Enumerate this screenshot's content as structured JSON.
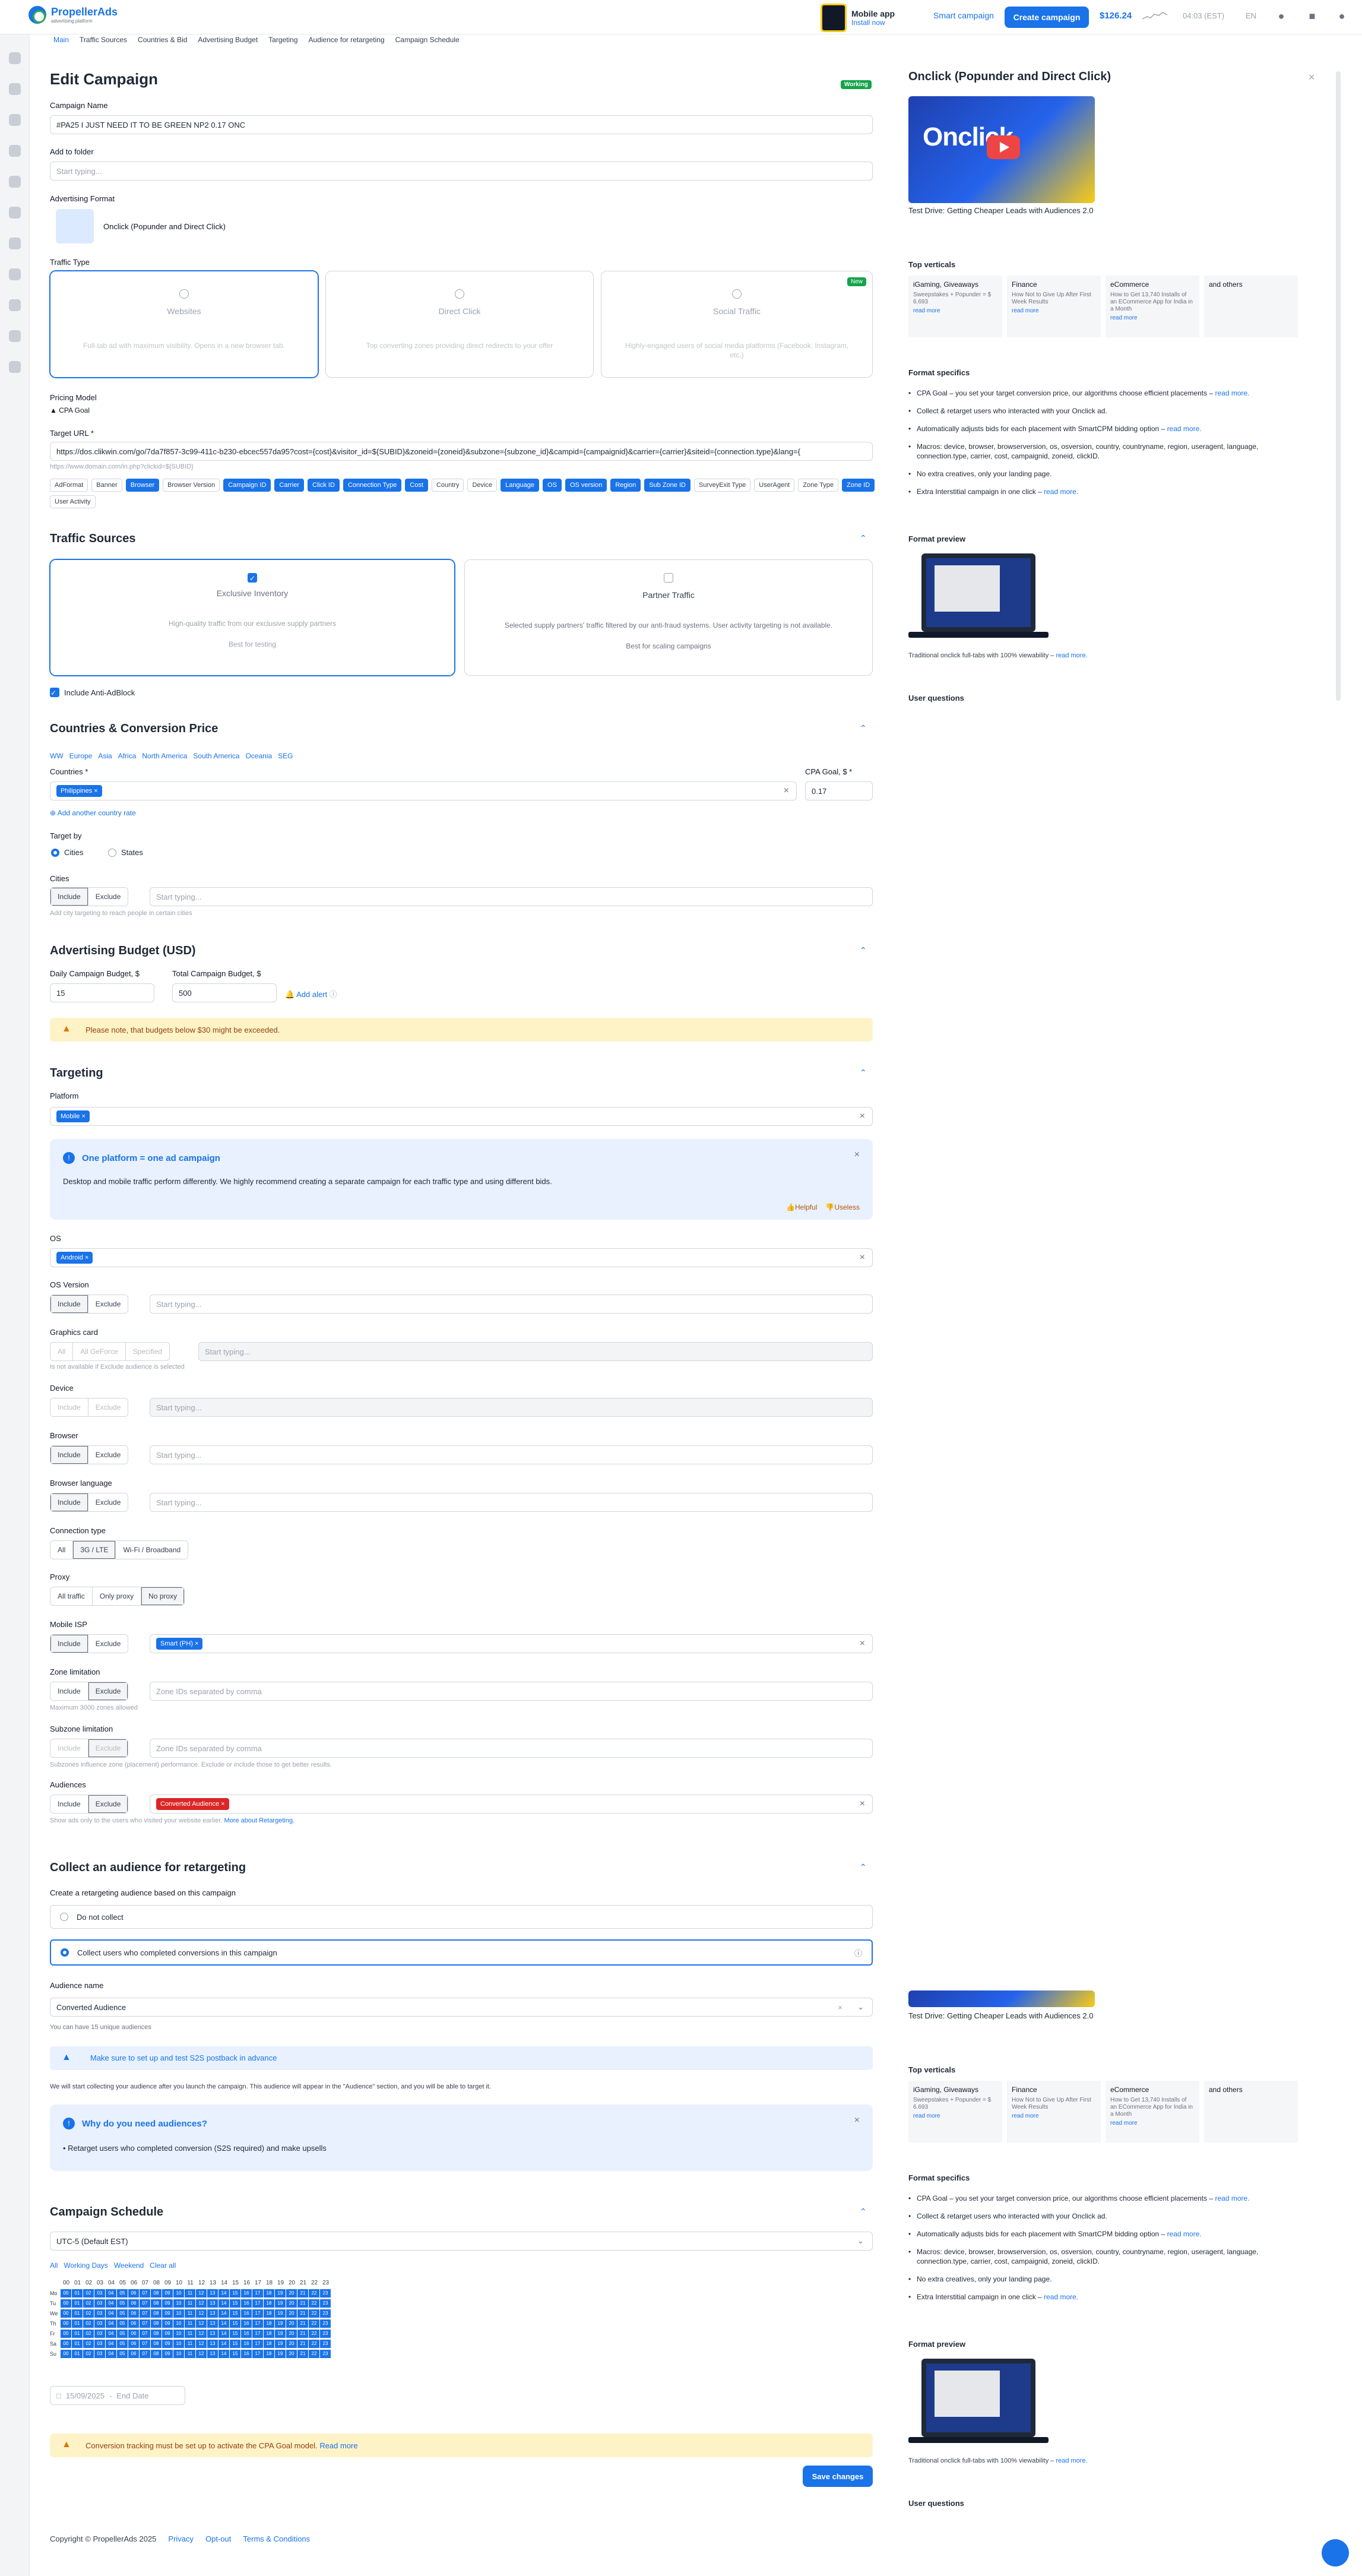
{
  "header": {
    "logo_name": "PropellerAds",
    "logo_sub": "advertising platform",
    "mobile_app_title": "Mobile app",
    "mobile_app_link": "Install now",
    "smart_campaign": "Smart campaign",
    "create_campaign": "Create campaign",
    "balance": "$126.24",
    "time": "04:03 (EST)",
    "lang": "EN"
  },
  "subnav": [
    "Main",
    "Traffic Sources",
    "Countries & Bid",
    "Advertising Budget",
    "Targeting",
    "Audience for retargeting",
    "Campaign Schedule"
  ],
  "page": {
    "title": "Edit Campaign",
    "status": "Working",
    "campaign_name_label": "Campaign Name",
    "campaign_name": "#PA25 I JUST NEED IT TO BE GREEN NP2 0.17 ONC",
    "folder_label": "Add to folder",
    "folder_placeholder": "Start typing...",
    "format_label": "Advertising Format",
    "format_value": "Onclick (Popunder and Direct Click)",
    "traffic_type_label": "Traffic Type",
    "traffic_types": [
      {
        "title": "Websites",
        "desc": "Full-tab ad with maximum visibility. Opens in a new browser tab."
      },
      {
        "title": "Direct Click",
        "desc": "Top converting zones providing direct redirects to your offer"
      },
      {
        "title": "Social Traffic",
        "desc": "Highly-engaged users of social media platforms (Facebook, Instagram, etc.)",
        "badge": "New"
      }
    ],
    "pricing_label": "Pricing Model",
    "pricing_value": "CPA Goal",
    "target_url_label": "Target URL *",
    "target_url": "https://dos.clikwin.com/go/7da7f857-3c99-411c-b230-ebcec557da95?cost={cost}&visitor_id=${SUBID}&zoneid={zoneid}&subzone={subzone_id}&campid={campaignid}&carrier={carrier}&siteid={connection.type}&lang={",
    "target_url_hint": "https://www.domain.com/in.php?clickid=${SUBID}",
    "macros": [
      {
        "t": "AdFormat",
        "on": false
      },
      {
        "t": "Banner",
        "on": false
      },
      {
        "t": "Browser",
        "on": true
      },
      {
        "t": "Browser Version",
        "on": false
      },
      {
        "t": "Campaign ID",
        "on": true
      },
      {
        "t": "Carrier",
        "on": true
      },
      {
        "t": "Click ID",
        "on": true
      },
      {
        "t": "Connection Type",
        "on": true
      },
      {
        "t": "Cost",
        "on": true
      },
      {
        "t": "Country",
        "on": false
      },
      {
        "t": "Device",
        "on": false
      },
      {
        "t": "Language",
        "on": true
      },
      {
        "t": "OS",
        "on": true
      },
      {
        "t": "OS version",
        "on": true
      },
      {
        "t": "Region",
        "on": true
      },
      {
        "t": "Sub Zone ID",
        "on": true
      },
      {
        "t": "SurveyExit Type",
        "on": false
      },
      {
        "t": "UserAgent",
        "on": false
      },
      {
        "t": "Zone Type",
        "on": false
      },
      {
        "t": "Zone ID",
        "on": true
      },
      {
        "t": "User Activity",
        "on": false
      }
    ]
  },
  "traffic_sources": {
    "title": "Traffic Sources",
    "exclusive_title": "Exclusive Inventory",
    "exclusive_desc": "High-quality traffic from our exclusive supply partners",
    "exclusive_foot": "Best for testing",
    "partner_title": "Partner Traffic",
    "partner_desc": "Selected supply partners' traffic filtered by our anti-fraud systems. User activity targeting is not available.",
    "partner_foot": "Best for scaling campaigns",
    "antiadblock": "Include Anti-AdBlock"
  },
  "countries": {
    "title": "Countries & Conversion Price",
    "regions": [
      "WW",
      "Europe",
      "Asia",
      "Africa",
      "North America",
      "South America",
      "Oceania",
      "SEG"
    ],
    "countries_label": "Countries *",
    "country_tag": "Philippines",
    "cpa_label": "CPA Goal, $ *",
    "cpa_value": "0.17",
    "add_rate": "Add another country rate",
    "target_by": "Target by",
    "cities": "Cities",
    "states": "States",
    "cities_label": "Cities",
    "include": "Include",
    "exclude": "Exclude",
    "cities_placeholder": "Start typing...",
    "cities_hint": "Add city targeting to reach people in certain cities"
  },
  "budget": {
    "title": "Advertising Budget (USD)",
    "daily_label": "Daily Campaign Budget, $",
    "daily": "15",
    "total_label": "Total Campaign Budget, $",
    "total": "500",
    "add_alert": "Add alert",
    "warning": "Please note, that budgets below $30 might be exceeded."
  },
  "targeting": {
    "title": "Targeting",
    "platform_label": "Platform",
    "platform_tag": "Mobile",
    "info_title": "One platform = one ad campaign",
    "info_text": "Desktop and mobile traffic perform differently. We highly recommend creating a separate campaign for each traffic type and using different bids.",
    "helpful": "Helpful",
    "useless": "Useless",
    "os_label": "OS",
    "os_tag": "Android",
    "osv_label": "OS Version",
    "gc_label": "Graphics card",
    "gc_all": "All",
    "gc_geforce": "All GeForce",
    "gc_specified": "Specified",
    "gc_hint": "Is not available if Exclude audience is selected",
    "device_label": "Device",
    "browser_label": "Browser",
    "blang_label": "Browser language",
    "conn_label": "Connection type",
    "conn": [
      "All",
      "3G / LTE",
      "Wi-Fi / Broadband"
    ],
    "proxy_label": "Proxy",
    "proxy": [
      "All traffic",
      "Only proxy",
      "No proxy"
    ],
    "isp_label": "Mobile ISP",
    "isp_tag": "Smart (PH)",
    "zone_label": "Zone limitation",
    "zone_placeholder": "Zone IDs separated by comma",
    "zone_hint": "Maximum 3000 zones allowed",
    "subzone_label": "Subzone limitation",
    "subzone_hint": "Subzones influence zone (placement) performance. Exclude or include those to get better results.",
    "aud_label": "Audiences",
    "aud_tag": "Converted Audience",
    "aud_hint": "Show ads only to the users who visited your website earlier.",
    "aud_link": "More about Retargeting.",
    "placeholder": "Start typing..."
  },
  "retargeting": {
    "title": "Collect an audience for retargeting",
    "subtitle": "Create a retargeting audience based on this campaign",
    "opt1": "Do not collect",
    "opt2": "Collect users who completed conversions in this campaign",
    "aud_name_label": "Audience name",
    "aud_name": "Converted Audience",
    "aud_count": "You can have 15 unique audiences",
    "s2s": "Make sure to set up and test S2S postback in advance",
    "note": "We will start collecting your audience after you launch the campaign. This audience will appear in the \"Audience\" section, and you will be able to target it.",
    "why_title": "Why do you need audiences?",
    "why_text": "• Retarget users who completed conversion (S2S required) and make upsells"
  },
  "schedule": {
    "title": "Campaign Schedule",
    "tz": "UTC-5 (Default EST)",
    "quick": [
      "All",
      "Working Days",
      "Weekend",
      "Clear all"
    ],
    "days": [
      "Mo",
      "Tu",
      "We",
      "Th",
      "Fr",
      "Sa",
      "Su"
    ],
    "hours": [
      "00",
      "01",
      "02",
      "03",
      "04",
      "05",
      "06",
      "07",
      "08",
      "09",
      "10",
      "11",
      "12",
      "13",
      "14",
      "15",
      "16",
      "17",
      "18",
      "19",
      "20",
      "21",
      "22",
      "23"
    ],
    "start_date": "15/09/2025",
    "end_date": "End Date",
    "cpa_warning": "Conversion tracking must be set up to activate the CPA Goal model.",
    "read_more": "Read more",
    "save": "Save changes"
  },
  "footer": {
    "copy": "Copyright © PropellerAds 2025",
    "links": [
      "Privacy",
      "Opt-out",
      "Terms & Conditions"
    ]
  },
  "panel": {
    "title": "Onclick (Popunder and Direct Click)",
    "video_word": "Onclick",
    "video_caption": "Test Drive: Getting Cheaper Leads with Audiences 2.0",
    "top_verticals": "Top verticals",
    "verticals": [
      {
        "name": "iGaming, Giveaways",
        "desc": "Sweepstakes + Popunder = $ 6.693",
        "link": "read more"
      },
      {
        "name": "Finance",
        "desc": "How Not to Give Up After First Week Results",
        "link": "read more"
      },
      {
        "name": "eCommerce",
        "desc": "How to Get 13,740 Installs of an ECommerce App for India in a Month",
        "link": "read more"
      },
      {
        "name": "and others",
        "desc": "",
        "link": ""
      }
    ],
    "format_specifics": "Format specifics",
    "specifics": [
      "CPA Goal – you set your target conversion price, our algorithms choose efficient placements –",
      "Collect & retarget users who interacted with your Onclick ad.",
      "Automatically adjusts bids for each placement with SmartCPM bidding option –",
      "Macros: device, browser, browserversion, os, osversion, country, countryname, region, useragent, language, connection.type, carrier, cost, campaignid, zoneid, clickID.",
      "No extra creatives, only your landing page.",
      "Extra Interstitial campaign in one click –"
    ],
    "read_more": "read more.",
    "format_preview": "Format preview",
    "preview_caption": "Traditional onclick full-tabs with 100% viewability –",
    "user_questions": "User questions"
  }
}
